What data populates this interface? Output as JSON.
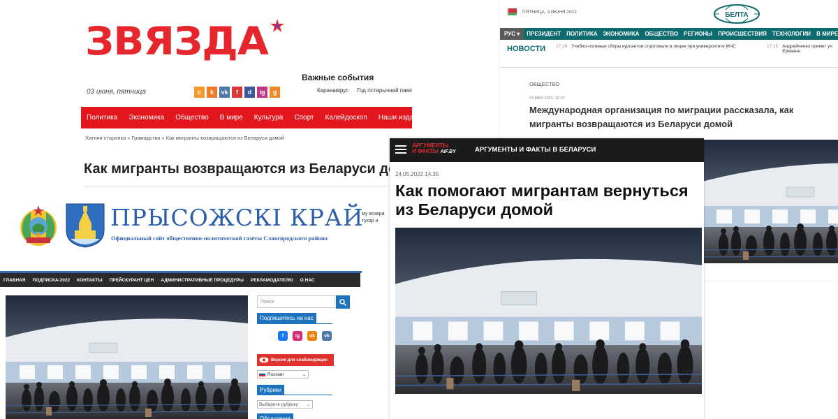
{
  "zviazda": {
    "logo": "ЗВЯЗДА",
    "date": "03 июня, пятница",
    "social": [
      {
        "label": "c",
        "color": "#f39a2b"
      },
      {
        "label": "k",
        "color": "#f07a28"
      },
      {
        "label": "vk",
        "color": "#4a76a8"
      },
      {
        "label": "f",
        "color": "#d9353a"
      },
      {
        "label": "d",
        "color": "#3b5998"
      },
      {
        "label": "ig",
        "color": "#c13584"
      },
      {
        "label": "g",
        "color": "#ee8a26"
      }
    ],
    "events_title": "Важные события",
    "events": [
      "Каранавірус",
      "Год гістарычнай памяці"
    ],
    "menu": [
      "Политика",
      "Экономика",
      "Общество",
      "В мире",
      "Культура",
      "Спорт",
      "Калейдоскоп",
      "Наши издания"
    ],
    "breadcrumbs": "Хатняя старонка » Грамадства » Как мигранты возвращаются из Беларуси домой",
    "title": "Как мигранты возвращаются из Беларуси домой",
    "accent": "#e4161d"
  },
  "belta": {
    "date": "ПЯТНИЦА, 3 ИЮНЯ 2022",
    "logo": "БЕЛТА",
    "lang": "РУС",
    "nav": [
      "ПРЕЗИДЕНТ",
      "ПОЛИТИКА",
      "ЭКОНОМИКА",
      "ОБЩЕСТВО",
      "РЕГИОНЫ",
      "ПРОИСШЕСТВИЯ",
      "ТЕХНОЛОГИИ",
      "В МИРЕ"
    ],
    "news_label": "НОВОСТИ",
    "ticker": [
      {
        "time": "17:26",
        "text": "Учебно-полевые сборы курсантов стартовали в лицее при университете МЧС"
      },
      {
        "time": "17:15",
        "text": "Андрейченко примет уч Ереване"
      }
    ],
    "section": "ОБЩЕСТВО",
    "datetime": "24 МАЯ 2022, 12:10",
    "title": "Международная организация по миграции рассказала, как мигранты возвращаются из Беларуси домой",
    "accent": "#0d6b6f"
  },
  "prisozhski": {
    "site_title": "ПРЫСОЖСКІ КРАЙ",
    "site_subtitle": "Официальный сайт общественно-политической газеты Славгородского района",
    "nav": [
      "ГЛАВНАЯ",
      "ПОДПИСКА-2022",
      "КОНТАКТЫ",
      "ПРЕЙСКУРАНТ ЦЕН",
      "АДМИНИСТРАТИВНЫЕ ПРОЦЕДУРЫ",
      "РЕКЛАМОДАТЕЛЮ",
      "О НАС"
    ],
    "search_placeholder": "Поиск",
    "subscribe_title": "Подпишитесь на нас",
    "social_icons": [
      {
        "name": "facebook-icon",
        "label": "f",
        "color": "#1877f2"
      },
      {
        "name": "instagram-icon",
        "label": "ig",
        "color": "#d62976"
      },
      {
        "name": "odnoklassniki-icon",
        "label": "ok",
        "color": "#ee8208"
      },
      {
        "name": "vk-icon",
        "label": "vk",
        "color": "#4a76a8"
      }
    ],
    "vision_button": "Версия для слабовидящих",
    "language": "Russian",
    "rubrics_title": "Рубрики",
    "rubric_placeholder": "Выберите рубрику",
    "next_widget": "Обращения",
    "accent": "#1e73be"
  },
  "aif": {
    "logo_line1": "АРГУМЕНТЫ",
    "logo_line2": "И ФАКТЫ",
    "logo_domain": "AIF.BY",
    "bar_title": "АРГУМЕНТЫ И ФАКТЫ В БЕЛАРУСИ",
    "datetime": "24.05.2022 14:35",
    "title": "Как помогают мигрантам вернуться из Беларуси домой",
    "accent": "#e42c32"
  },
  "peek_text": [
    "му возвра",
    "тукар и"
  ]
}
